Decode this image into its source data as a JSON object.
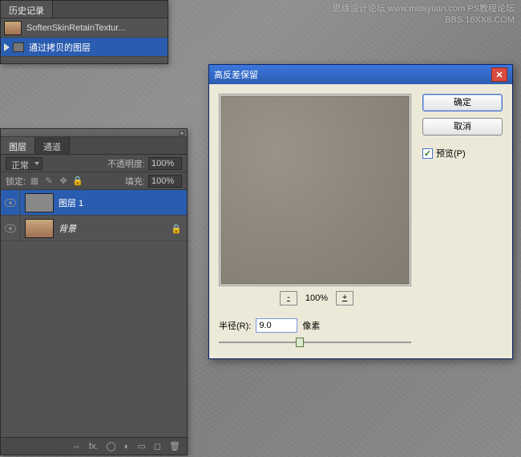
{
  "watermark": {
    "line1": "思缘设计论坛  www.missyuan.com  PS教程论坛",
    "line2": "BBS.16XX8.COM"
  },
  "history": {
    "tab": "历史记录",
    "rows": [
      {
        "label": "SoftenSkinRetainTextur...",
        "selected": false
      },
      {
        "label": "通过拷贝的图层",
        "selected": true
      }
    ]
  },
  "layers": {
    "tabs": [
      "图层",
      "通道"
    ],
    "active_tab": 0,
    "blend_mode": "正常",
    "opacity_label": "不透明度:",
    "opacity_value": "100%",
    "lock_label": "锁定:",
    "fill_label": "填充:",
    "fill_value": "100%",
    "rows": [
      {
        "name": "图层 1",
        "selected": true,
        "locked": false,
        "italic": false
      },
      {
        "name": "背景",
        "selected": false,
        "locked": true,
        "italic": true
      }
    ],
    "footer_icons": [
      "fx.",
      "◯",
      "◐",
      "▦",
      "◻",
      "🗑"
    ]
  },
  "dialog": {
    "title": "高反差保留",
    "ok": "确定",
    "cancel": "取消",
    "preview_label": "预览(P)",
    "preview_checked": true,
    "zoom_minus": "-",
    "zoom_value": "100%",
    "zoom_plus": "+",
    "radius_label": "半径(R):",
    "radius_value": "9.0",
    "radius_unit": "像素",
    "slider_pos_pct": 40
  }
}
